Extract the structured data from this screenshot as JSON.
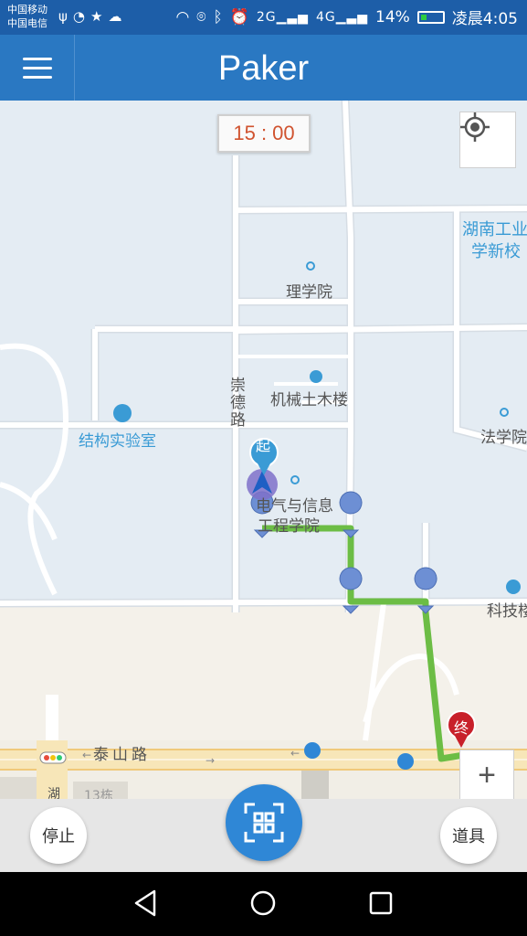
{
  "status_bar": {
    "carrier_1": "中国移动",
    "carrier_2": "中国电信",
    "battery": "14%",
    "time": "凌晨4:05",
    "net_1": "2G",
    "net_2": "4G"
  },
  "app_bar": {
    "title": "Paker",
    "menu_icon": "hamburger-menu-icon"
  },
  "map": {
    "timer": "15 : 00",
    "labels": {
      "hunan_1": "湖南工业",
      "hunan_2": "学新校",
      "science": "理学院",
      "mech": "机械土木楼",
      "struct_lab": "结构实验室",
      "law": "法学院",
      "elec_1": "电气与信息",
      "elec_2": "工程学院",
      "tech": "科技楼",
      "road_chongde": "崇德路",
      "road_taishan": "泰山路",
      "building_13": "13栋",
      "road_hu": "湖"
    },
    "markers": {
      "start": "起",
      "end": "终"
    },
    "route_color": "#6cbd45",
    "icons": [
      "locate-icon",
      "zoom-in-icon",
      "traffic-light-icon",
      "bus-stop-icon"
    ]
  },
  "controls": {
    "stop": "停止",
    "props": "道具",
    "scan_icon": "qr-scan-icon"
  },
  "nav_bar": {
    "back": "back-icon",
    "home": "home-icon",
    "recents": "recents-icon"
  }
}
